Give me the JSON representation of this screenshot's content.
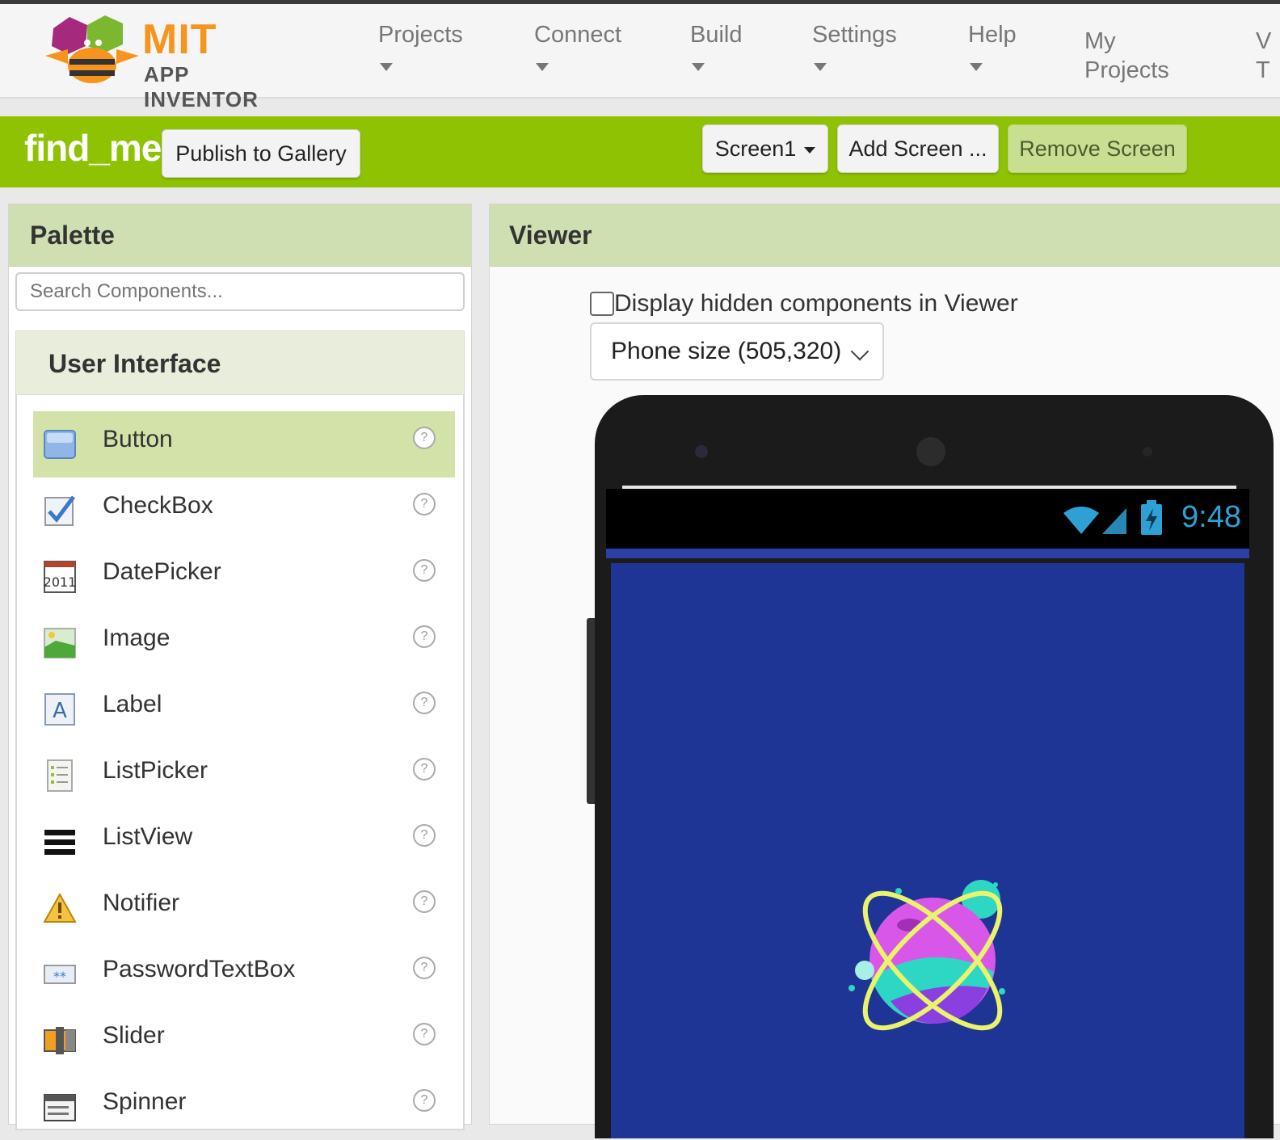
{
  "header": {
    "logo_main": "MIT",
    "logo_sub": "APP INVENTOR",
    "nav": [
      {
        "label": "Projects"
      },
      {
        "label": "Connect"
      },
      {
        "label": "Build"
      },
      {
        "label": "Settings"
      },
      {
        "label": "Help"
      },
      {
        "label_line1": "My",
        "label_line2": "Projects"
      },
      {
        "label_line1": "V",
        "label_line2": "T"
      }
    ]
  },
  "project": {
    "name": "find_me",
    "publish_button": "Publish to Gallery",
    "screen_select": "Screen1",
    "add_screen_button": "Add Screen ...",
    "remove_screen_button": "Remove Screen"
  },
  "palette": {
    "title": "Palette",
    "search_placeholder": "Search Components...",
    "section": "User Interface",
    "items": [
      {
        "label": "Button",
        "icon": "button-icon",
        "selected": true
      },
      {
        "label": "CheckBox",
        "icon": "checkbox-icon"
      },
      {
        "label": "DatePicker",
        "icon": "datepicker-icon"
      },
      {
        "label": "Image",
        "icon": "image-icon"
      },
      {
        "label": "Label",
        "icon": "label-icon"
      },
      {
        "label": "ListPicker",
        "icon": "listpicker-icon"
      },
      {
        "label": "ListView",
        "icon": "listview-icon"
      },
      {
        "label": "Notifier",
        "icon": "notifier-icon"
      },
      {
        "label": "PasswordTextBox",
        "icon": "password-icon"
      },
      {
        "label": "Slider",
        "icon": "slider-icon"
      },
      {
        "label": "Spinner",
        "icon": "spinner-icon"
      }
    ],
    "help_glyph": "?",
    "datepicker_glyph": "2011",
    "label_glyph": "A",
    "password_glyph": "**"
  },
  "viewer": {
    "title": "Viewer",
    "hidden_checkbox_label": "Display hidden components in Viewer",
    "hidden_checked": false,
    "phone_size": "Phone size (505,320)",
    "status_time": "9:48"
  },
  "colors": {
    "brand_green": "#8fc202",
    "app_background": "#1e3595",
    "status_time": "#2ea0d4"
  }
}
